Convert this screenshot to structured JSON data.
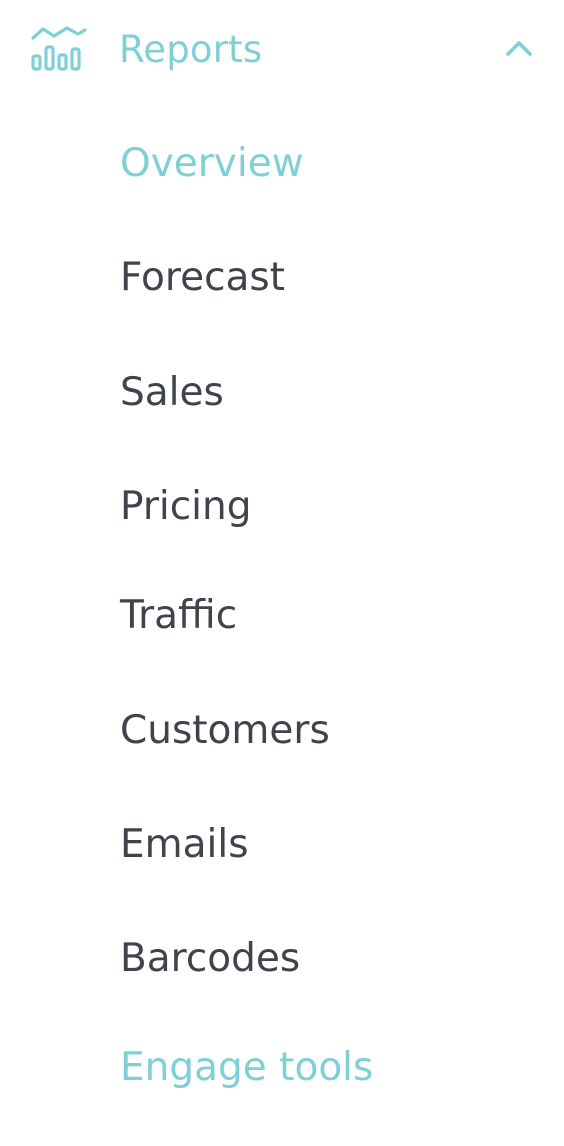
{
  "section": {
    "title": "Reports",
    "icon": "reports-chart-icon",
    "toggle_icon": "chevron-up-icon",
    "expanded": true
  },
  "colors": {
    "accent": "#7fd0d6",
    "text": "#3f434b",
    "background": "#ffffff"
  },
  "items": [
    {
      "label": "Overview",
      "state": "active"
    },
    {
      "label": "Forecast"
    },
    {
      "label": "Sales"
    },
    {
      "label": "Pricing"
    },
    {
      "label": "Traffic"
    },
    {
      "label": "Customers"
    },
    {
      "label": "Emails"
    },
    {
      "label": "Barcodes"
    },
    {
      "label": "Engage tools",
      "state": "accent"
    }
  ]
}
